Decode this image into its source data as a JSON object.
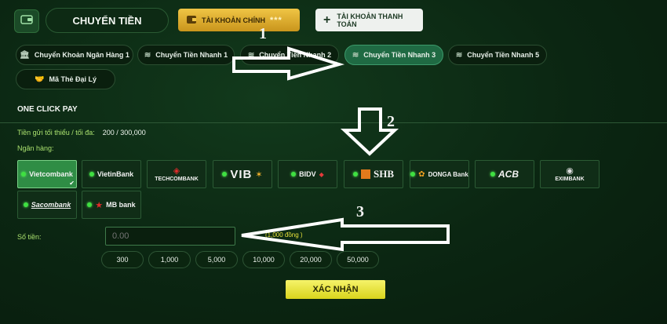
{
  "header": {
    "title": "CHUYỂN TIỀN",
    "main_account": "TÀI KHOẢN CHÍNH",
    "main_account_mask": "***",
    "payment_account": "TÀI KHOẢN THANH TOÁN"
  },
  "tabs": [
    {
      "label": "Chuyển Khoản Ngân Hàng 1"
    },
    {
      "label": "Chuyển Tiền Nhanh 1"
    },
    {
      "label": "Chuyển Tiền Nhanh 2"
    },
    {
      "label": "Chuyển Tiền Nhanh 3"
    },
    {
      "label": "Chuyển Tiền Nhanh 5"
    },
    {
      "label": "Mã Thẻ Đại Lý"
    }
  ],
  "section_title": "ONE CLICK PAY",
  "limit": {
    "label": "Tiền gửi tối thiểu / tối đa:",
    "value": "200 / 300,000"
  },
  "bank_label": "Ngân hàng:",
  "banks": [
    {
      "name": "Vietcombank"
    },
    {
      "name": "VietinBank"
    },
    {
      "name": "TECHCOMBANK"
    },
    {
      "name": "VIB"
    },
    {
      "name": "BIDV"
    },
    {
      "name": "SHB"
    },
    {
      "name": "DONGA Bank"
    },
    {
      "name": "ACB"
    },
    {
      "name": "EXIMBANK"
    },
    {
      "name": "Sacombank"
    },
    {
      "name": "MB bank"
    }
  ],
  "amount": {
    "label": "Số tiền:",
    "placeholder": "0.00",
    "unit_note": "(1,000 đồng )"
  },
  "quick_amounts": [
    "300",
    "1,000",
    "5,000",
    "10,000",
    "20,000",
    "50,000"
  ],
  "confirm_label": "XÁC NHẬN",
  "annotations": [
    "1",
    "2",
    "3"
  ],
  "colors": {
    "accent_green": "#1f6a43",
    "gold": "#e6b93a",
    "confirm_yellow": "#eeea40",
    "label_green": "#a9e06e"
  }
}
